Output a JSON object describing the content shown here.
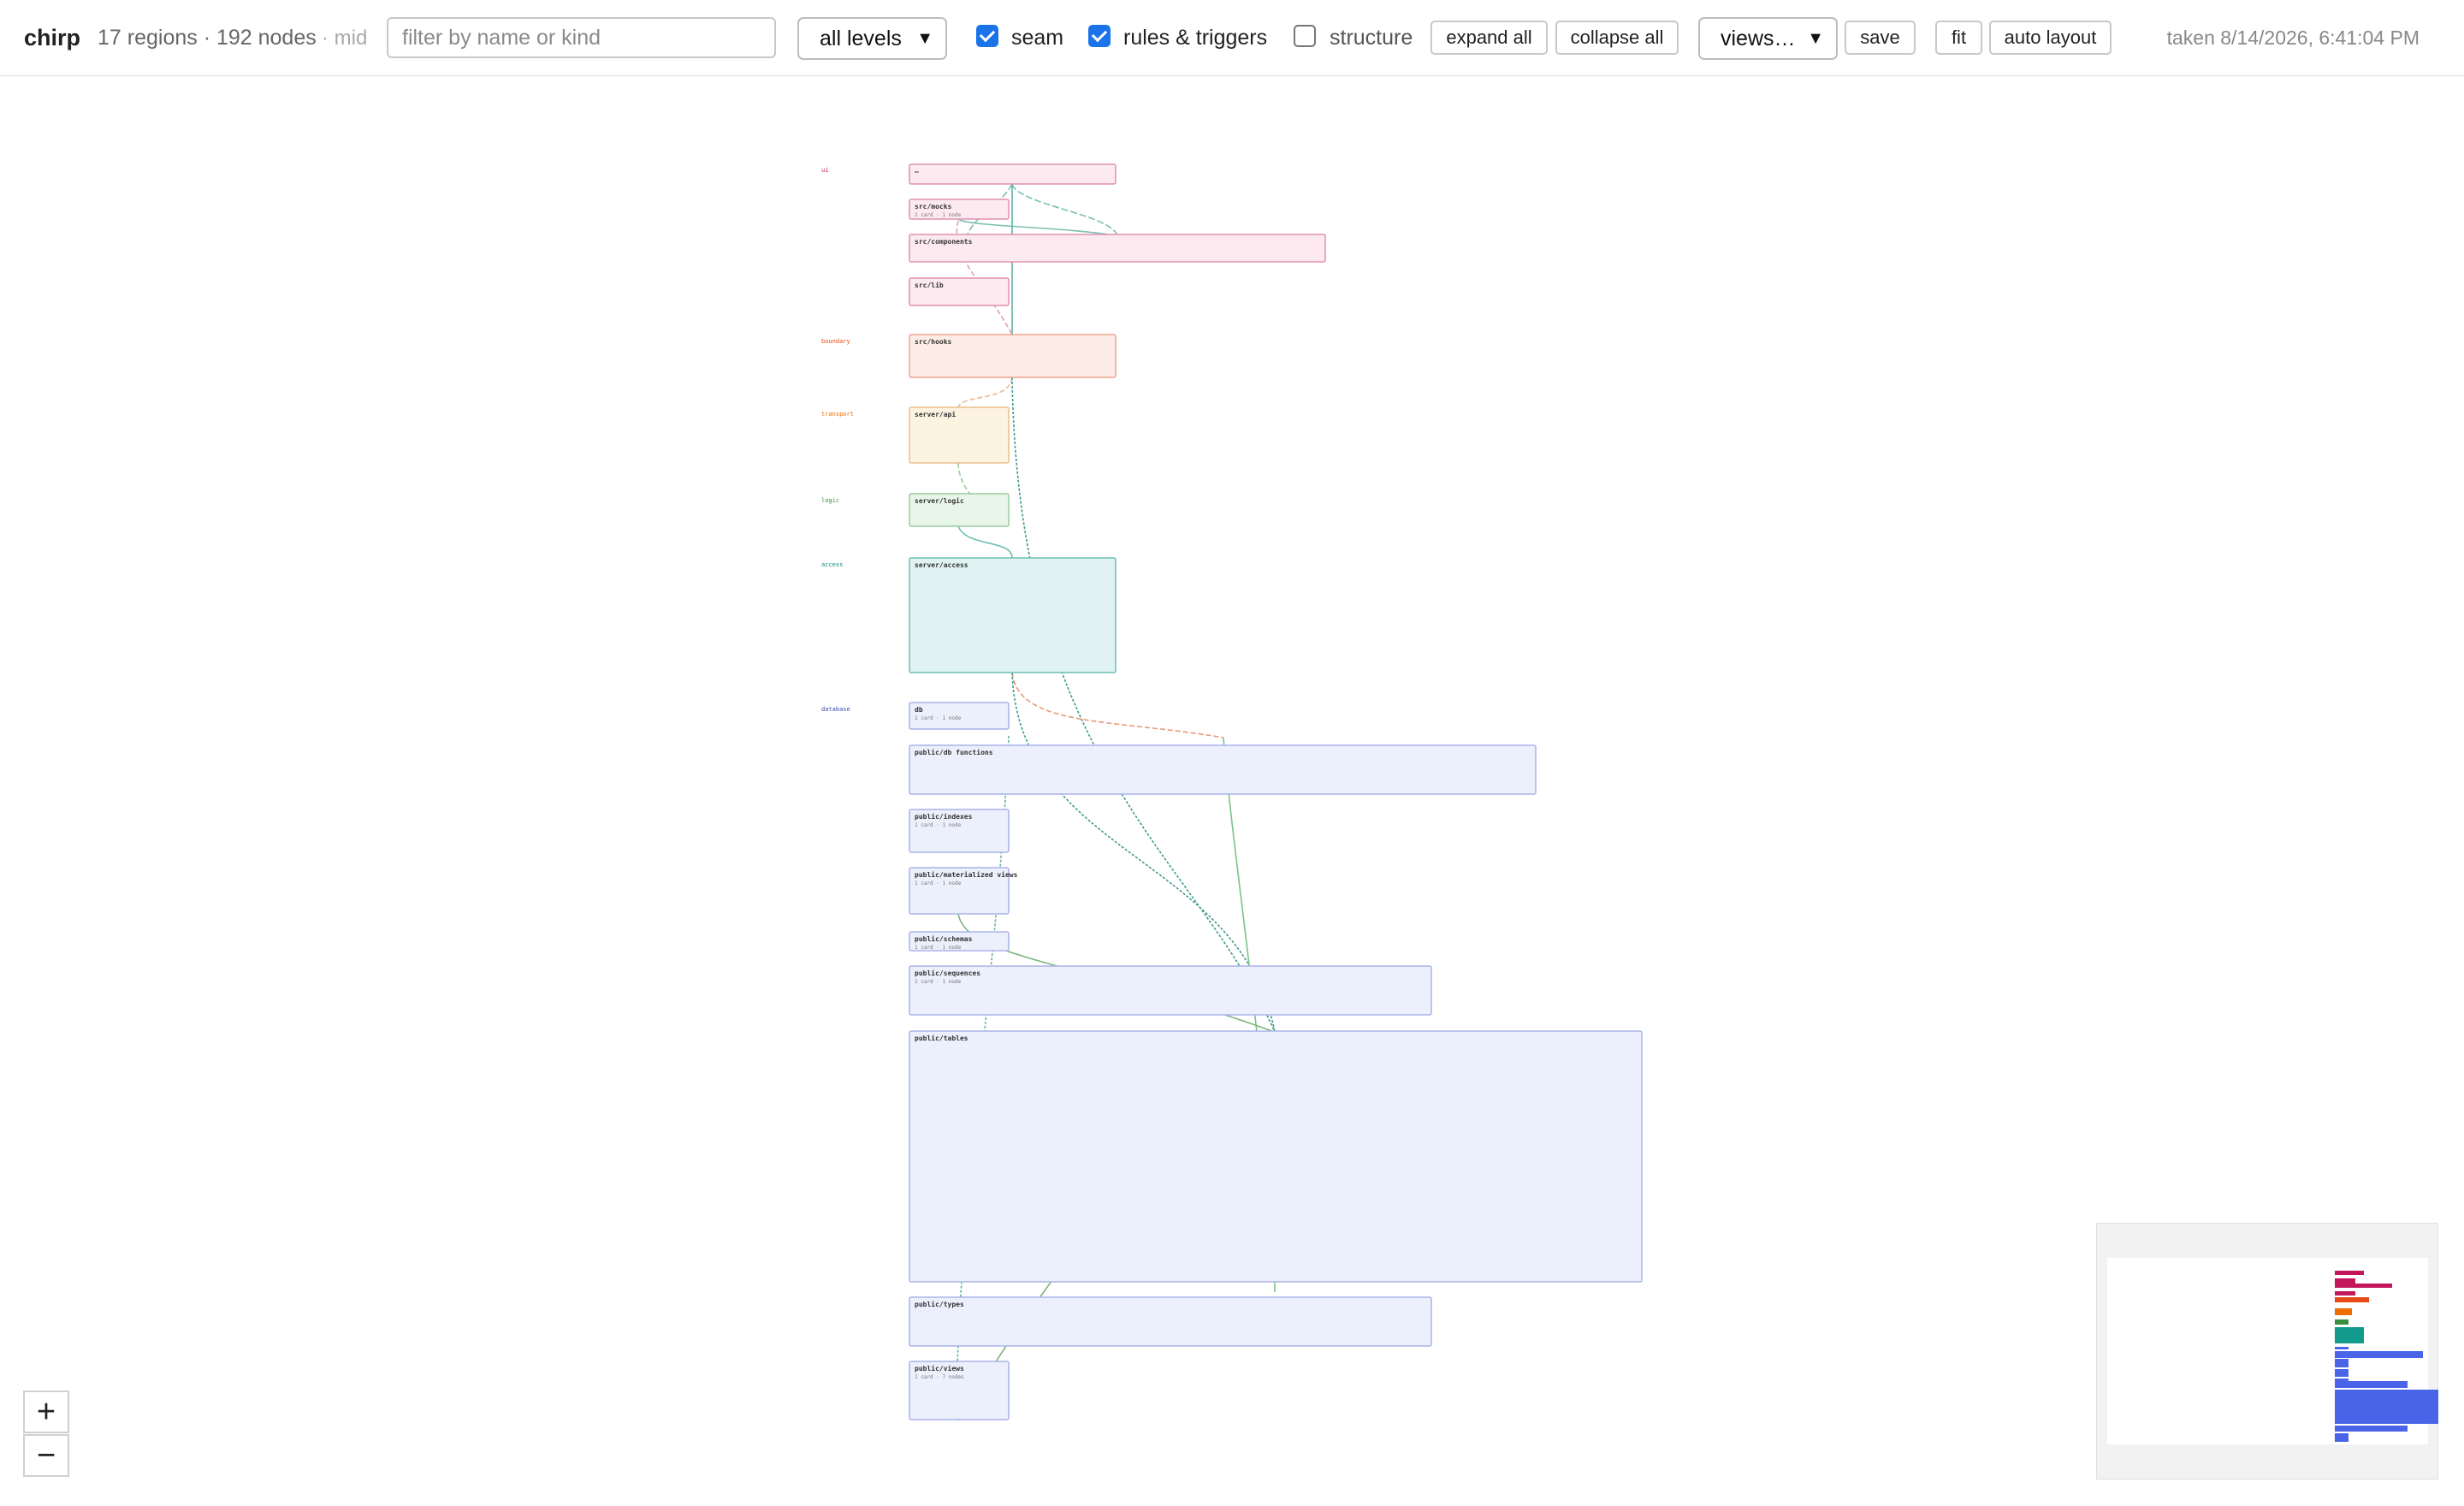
{
  "app": {
    "title": "chirp",
    "counts": "17 regions · 192 nodes",
    "zoom_detail": "· mid",
    "timestamp": "taken 8/14/2026, 6:41:04 PM"
  },
  "toolbar": {
    "filter_placeholder": "filter by name or kind",
    "filter_value": "",
    "level_select": "all levels",
    "seam_label": "seam",
    "seam_checked": true,
    "rules_label": "rules & triggers",
    "rules_checked": true,
    "structure_label": "structure",
    "structure_checked": false,
    "expand_all": "expand all",
    "collapse_all": "collapse all",
    "views_select": "views…",
    "save": "save",
    "fit": "fit",
    "auto_layout": "auto layout"
  },
  "zoom": {
    "in": "+",
    "out": "−"
  },
  "layers": [
    {
      "id": "ui",
      "color": "#c2185b"
    },
    {
      "id": "boundary",
      "color": "#e64a19"
    },
    {
      "id": "transport",
      "color": "#ef6c00"
    },
    {
      "id": "logic",
      "color": "#388e3c"
    },
    {
      "id": "access",
      "color": "#00897b"
    },
    {
      "id": "database",
      "color": "#3949ab"
    }
  ],
  "regions": [
    {
      "title": "",
      "sub": "",
      "layer": "ui"
    },
    {
      "title": "src/mocks",
      "sub": "1 card · 1 node",
      "layer": "ui"
    },
    {
      "title": "src/components",
      "sub": "",
      "layer": "ui"
    },
    {
      "title": "src/lib",
      "sub": "",
      "layer": "ui"
    },
    {
      "title": "src/hooks",
      "sub": "",
      "layer": "boundary"
    },
    {
      "title": "server/api",
      "sub": "",
      "layer": "transport"
    },
    {
      "title": "server/logic",
      "sub": "",
      "layer": "logic"
    },
    {
      "title": "server/access",
      "sub": "",
      "layer": "access"
    },
    {
      "title": "db",
      "sub": "1 card · 1 node",
      "layer": "database"
    },
    {
      "title": "public/db functions",
      "sub": "",
      "layer": "database"
    },
    {
      "title": "public/indexes",
      "sub": "1 card · 1 node",
      "layer": "database"
    },
    {
      "title": "public/materialized views",
      "sub": "1 card · 1 node",
      "layer": "database"
    },
    {
      "title": "public/schemas",
      "sub": "1 card · 1 node",
      "layer": "database"
    },
    {
      "title": "public/sequences",
      "sub": "1 card · 1 node",
      "layer": "database"
    },
    {
      "title": "public/tables",
      "sub": "",
      "layer": "database"
    },
    {
      "title": "public/types",
      "sub": "",
      "layer": "database"
    },
    {
      "title": "public/views",
      "sub": "1 card · 7 nodes",
      "layer": "database"
    }
  ]
}
